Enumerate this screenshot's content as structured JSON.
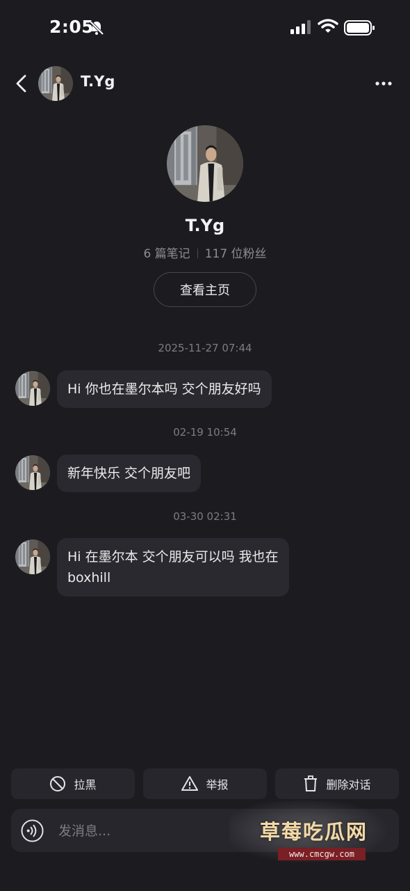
{
  "status_bar": {
    "time": "2:05"
  },
  "nav": {
    "title": "T.Yg"
  },
  "profile": {
    "name": "T.Yg",
    "notes_count": "6 篇笔记",
    "followers_count": "117 位粉丝",
    "view_profile_label": "查看主页"
  },
  "messages": [
    {
      "timestamp": "2025-11-27 07:44",
      "text": "Hi 你也在墨尔本吗 交个朋友好吗"
    },
    {
      "timestamp": "02-19 10:54",
      "text": "新年快乐 交个朋友吧"
    },
    {
      "timestamp": "03-30 02:31",
      "text_line1": "Hi 在墨尔本 交个朋友可以吗 我也在",
      "text_line2": "boxhill"
    }
  ],
  "actions": {
    "block_label": "拉黑",
    "report_label": "举报",
    "delete_label": "删除对话"
  },
  "input": {
    "placeholder": "发消息..."
  },
  "watermark": {
    "title": "草莓吃瓜网",
    "url": "www.cmcgw.com"
  },
  "icons": {
    "bell": "bell-slash-icon",
    "signal": "signal-icon",
    "wifi": "wifi-icon",
    "battery": "battery-icon",
    "back": "chevron-left-icon",
    "more": "more-icon",
    "block": "block-icon",
    "report": "warning-icon",
    "delete": "trash-icon",
    "voice": "voice-icon"
  },
  "colors": {
    "background": "#1c1b20",
    "bubble": "#2a292f",
    "button": "#27262c",
    "muted_text": "#8c8c92"
  }
}
